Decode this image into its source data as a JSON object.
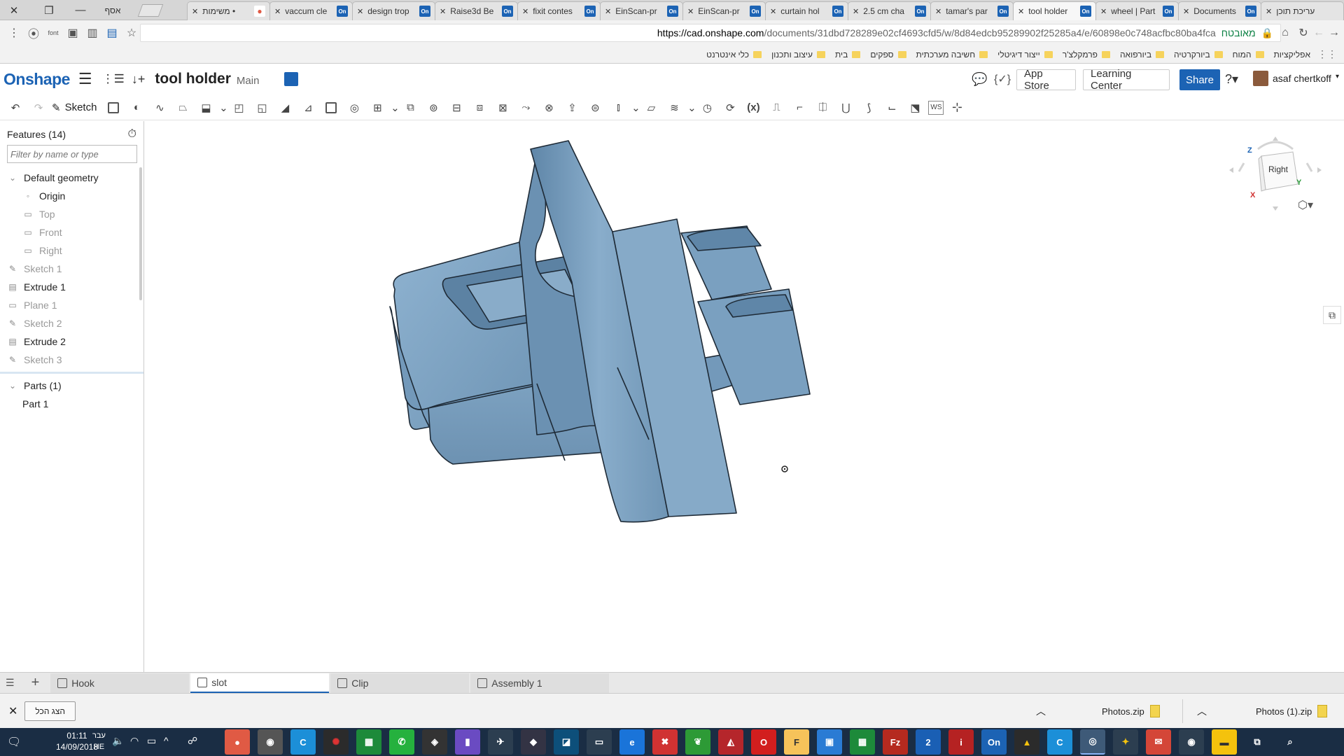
{
  "browser": {
    "tabs": [
      {
        "label": "עריכת תוכן",
        "favicon": "",
        "active": false
      },
      {
        "label": "Documents",
        "favicon": "On",
        "active": false
      },
      {
        "label": "wheel | Part",
        "favicon": "On",
        "active": false
      },
      {
        "label": "tool holder",
        "favicon": "On",
        "active": true
      },
      {
        "label": "tamar's par",
        "favicon": "On",
        "active": false
      },
      {
        "label": "2.5 cm cha",
        "favicon": "On",
        "active": false
      },
      {
        "label": "curtain hol",
        "favicon": "On",
        "active": false
      },
      {
        "label": "EinScan-pr",
        "favicon": "On",
        "active": false
      },
      {
        "label": "EinScan-pr",
        "favicon": "On",
        "active": false
      },
      {
        "label": "fixit contes",
        "favicon": "On",
        "active": false
      },
      {
        "label": "Raise3d Be",
        "favicon": "On",
        "active": false
      },
      {
        "label": "design trop",
        "favicon": "On",
        "active": false
      },
      {
        "label": "vaccum cle",
        "favicon": "On",
        "active": false
      },
      {
        "label": "משימות •",
        "favicon": "asana",
        "active": false
      }
    ],
    "profile_label": "אסף",
    "url_secure_label": "מאובטח",
    "url_host": "https://cad.onshape.com",
    "url_path": "/documents/31dbd728289e02cf4693cfd5/w/8d84edcb95289902f25285a4/e/60898e0c748acfbc80ba4fca",
    "bookmarks": [
      "אפליקציות",
      "המוח",
      "ביורקרטיה",
      "ביורפואה",
      "פרמקלצ'ר",
      "ייצור דיגיטלי",
      "חשיבה מערכתית",
      "ספקים",
      "בית",
      "עיצוב ותכנון",
      "כלי אינטרנט"
    ]
  },
  "header": {
    "logo": "Onshape",
    "doc_title": "tool holder",
    "branch": "Main",
    "app_store": "App Store",
    "learning_center": "Learning Center",
    "share": "Share",
    "user": "asaf chertkoff"
  },
  "toolbar": {
    "sketch_label": "Sketch",
    "ws_label": "WS",
    "variable_label": "(x)"
  },
  "features": {
    "title": "Features (14)",
    "filter_placeholder": "Filter by name or type",
    "default_geometry_label": "Default geometry",
    "items": [
      {
        "label": "Origin",
        "indent": true,
        "dim": false,
        "icon": "origin-icon"
      },
      {
        "label": "Top",
        "indent": true,
        "dim": true,
        "icon": "plane-icon"
      },
      {
        "label": "Front",
        "indent": true,
        "dim": true,
        "icon": "plane-icon"
      },
      {
        "label": "Right",
        "indent": true,
        "dim": true,
        "icon": "plane-icon"
      },
      {
        "label": "Sketch 1",
        "indent": false,
        "dim": true,
        "icon": "sketch-icon"
      },
      {
        "label": "Extrude 1",
        "indent": false,
        "dim": false,
        "icon": "extrude-icon"
      },
      {
        "label": "Plane 1",
        "indent": false,
        "dim": true,
        "icon": "plane-icon"
      },
      {
        "label": "Sketch 2",
        "indent": false,
        "dim": true,
        "icon": "sketch-icon"
      },
      {
        "label": "Extrude 2",
        "indent": false,
        "dim": false,
        "icon": "extrude-icon"
      },
      {
        "label": "Sketch 3",
        "indent": false,
        "dim": true,
        "icon": "sketch-icon"
      }
    ],
    "parts_label": "Parts (1)",
    "parts": [
      "Part 1"
    ]
  },
  "viewcube": {
    "face_label": "Right",
    "axis_z": "Z",
    "axis_y": "Y",
    "axis_x": "X"
  },
  "doc_tabs": [
    "Hook",
    "slot",
    "Clip",
    "Assembly 1"
  ],
  "active_doc_tab": "slot",
  "downloads": {
    "show_all": "הצג הכל",
    "files": [
      "Photos.zip",
      "Photos (1).zip"
    ]
  },
  "taskbar": {
    "time": "01:11",
    "date": "14/09/2018",
    "day": "עבר",
    "lang": "HE"
  },
  "colors": {
    "part_fill": "#7da2c1",
    "accent": "#1c63b4"
  }
}
